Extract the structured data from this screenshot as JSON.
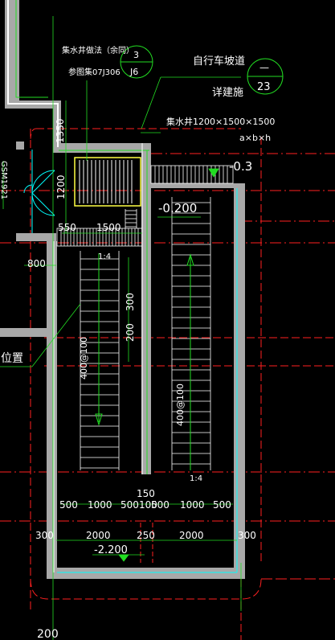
{
  "colors": {
    "background": "#000000",
    "wall": "#a8a8a8",
    "lines": "#ffffff",
    "axis": "#ff2020",
    "green": "#22dd22",
    "yellow": "#ffff44",
    "cyan": "#00ffff"
  },
  "callouts": {
    "sump_method": "集水井做法（余同）",
    "ref_atlas": "参图集07J306",
    "sump_detail_num": "3",
    "sump_sheet": "J6",
    "bike_ramp": "自行车坡道",
    "see_arch": "详建施",
    "ramp_detail_num": "—",
    "ramp_sheet": "23",
    "sump_size": "集水井1200×1500×1500",
    "sump_dims_key": "a×b×h"
  },
  "elevations": {
    "top_right": "-0.3",
    "landing": "-0.200",
    "bottom": "-2.200"
  },
  "door_tag": "GSM1921",
  "side_label": "位置",
  "stair_labels": {
    "left_flight": "400@100",
    "right_flight": "400@100",
    "left_slope": "1:4",
    "right_slope": "1:4"
  },
  "dims": {
    "d1350": "1350",
    "d1200": "1200",
    "d550": "550",
    "d1500": "1500",
    "d800": "800",
    "d200a": "200",
    "d300a": "300",
    "d150": "150",
    "row1": [
      "500",
      "1000",
      "500",
      "100",
      "500",
      "1000",
      "500"
    ],
    "row2": [
      "300",
      "2000",
      "250",
      "2000",
      "300"
    ],
    "d200b": "200"
  }
}
